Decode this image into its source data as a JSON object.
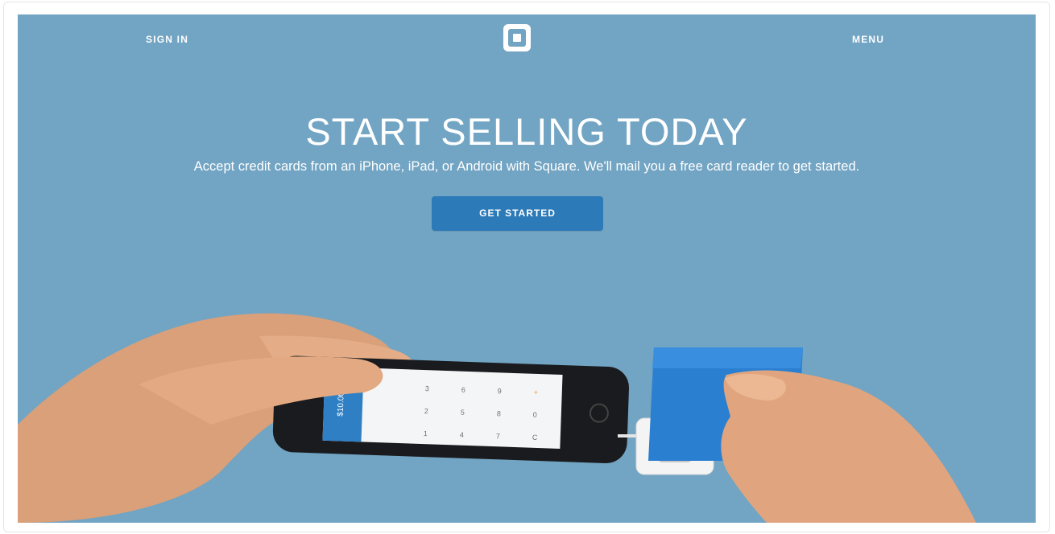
{
  "nav": {
    "sign_in": "SIGN IN",
    "menu": "MENU",
    "logo_icon": "square-logo-icon"
  },
  "hero": {
    "title": "START SELLING TODAY",
    "subtitle": "Accept credit cards from an iPhone, iPad, or Android with Square. We'll mail you a free card reader to get started.",
    "cta": "GET STARTED"
  },
  "photo": {
    "phone_total": "$10.00",
    "keypad": [
      "1",
      "2",
      "3",
      "4",
      "5",
      "6",
      "7",
      "8",
      "9",
      "C",
      "0",
      "+"
    ]
  },
  "colors": {
    "background": "#72a4c3",
    "button": "#2c7ab8",
    "text": "#ffffff",
    "card": "#2a7fd0"
  }
}
